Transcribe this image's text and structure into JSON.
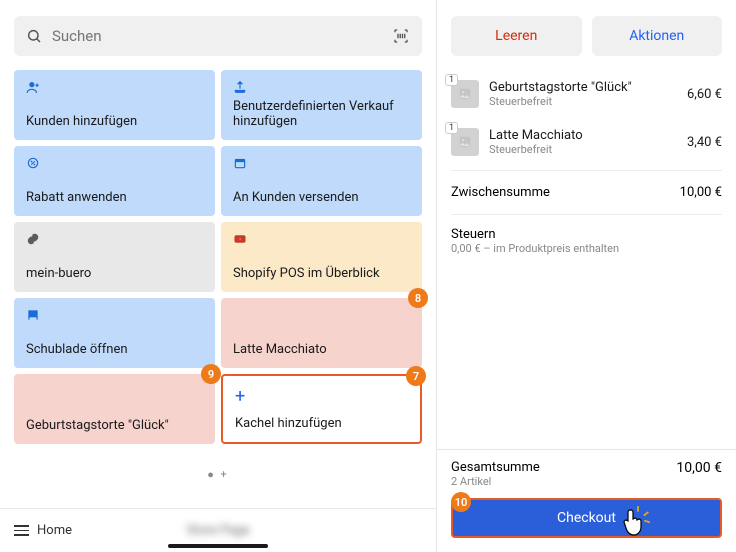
{
  "search": {
    "placeholder": "Suchen"
  },
  "tiles": [
    {
      "label": "Kunden hinzufügen"
    },
    {
      "label": "Benutzerdefinierten Verkauf hinzufügen"
    },
    {
      "label": "Rabatt anwenden"
    },
    {
      "label": "An Kunden versenden"
    },
    {
      "label": "mein-buero"
    },
    {
      "label": "Shopify POS im Überblick"
    },
    {
      "label": "Schublade öffnen"
    },
    {
      "label": "Latte Macchiato"
    },
    {
      "label": "Geburtstagstorte \"Glück\""
    },
    {
      "label": "Kachel hinzufügen"
    }
  ],
  "callouts": {
    "tile_latte": "8",
    "tile_cake": "9",
    "tile_add": "7",
    "checkout": "10"
  },
  "bottom": {
    "home": "Home",
    "blur": "Store Page"
  },
  "actions": {
    "clear": "Leeren",
    "more": "Aktionen"
  },
  "cart": {
    "items": [
      {
        "qty": "1",
        "name": "Geburtstagstorte \"Glück\"",
        "sub": "Steuerbefreit",
        "price": "6,60 €"
      },
      {
        "qty": "1",
        "name": "Latte Macchiato",
        "sub": "Steuerbefreit",
        "price": "3,40 €"
      }
    ],
    "subtotal_label": "Zwischensumme",
    "subtotal_value": "10,00 €",
    "tax_label": "Steuern",
    "tax_sub": "0,00 € – im Produktpreis enthalten"
  },
  "total": {
    "label": "Gesamtsumme",
    "count": "2 Artikel",
    "value": "10,00 €",
    "checkout": "Checkout"
  }
}
